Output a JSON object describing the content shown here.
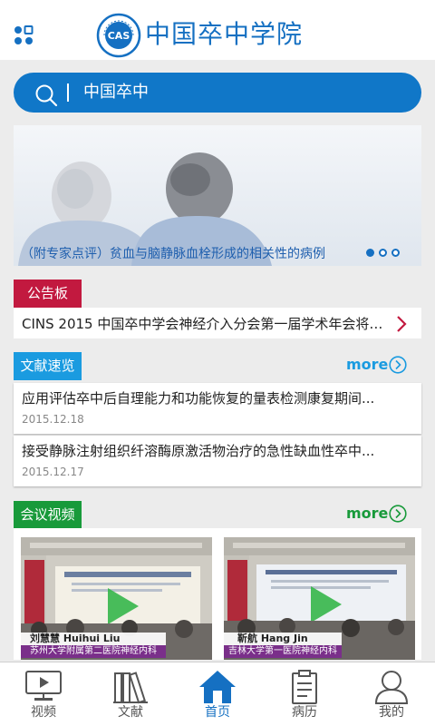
{
  "header": {
    "title": "中国卒中学院"
  },
  "search": {
    "text": "中国卒中"
  },
  "banner": {
    "caption": "（附专家点评）贫血与脑静脉血栓形成的相关性的病例"
  },
  "notice": {
    "tag": "公告板",
    "text": "CINS 2015 中国卒中学会神经介入分会第一届学术年会将于..."
  },
  "literature": {
    "tag": "文献速览",
    "more": "more",
    "items": [
      {
        "title": "应用评估卒中后自理能力和功能恢复的量表检测康复期间...",
        "date": "2015.12.18"
      },
      {
        "title": "接受静脉注射组织纤溶酶原激活物治疗的急性缺血性卒中...",
        "date": "2015.12.17"
      }
    ]
  },
  "video": {
    "tag": "会议视频",
    "more": "more",
    "items": [
      {
        "speaker": "刘慧慧  Huihui Liu",
        "affiliation": "苏州大学附属第二医院神经内科"
      },
      {
        "speaker": "靳航   Hang Jin",
        "affiliation": "吉林大学第一医院神经内科"
      }
    ]
  },
  "tabs": [
    {
      "label": "视频",
      "icon": "video-screen-icon"
    },
    {
      "label": "文献",
      "icon": "books-icon"
    },
    {
      "label": "首页",
      "icon": "home-icon",
      "active": true
    },
    {
      "label": "病历",
      "icon": "clipboard-icon"
    },
    {
      "label": "我的",
      "icon": "user-icon"
    }
  ],
  "colors": {
    "brand": "#1570c2",
    "notice": "#c2193f",
    "literature": "#1a9be0",
    "video": "#189a3a"
  }
}
